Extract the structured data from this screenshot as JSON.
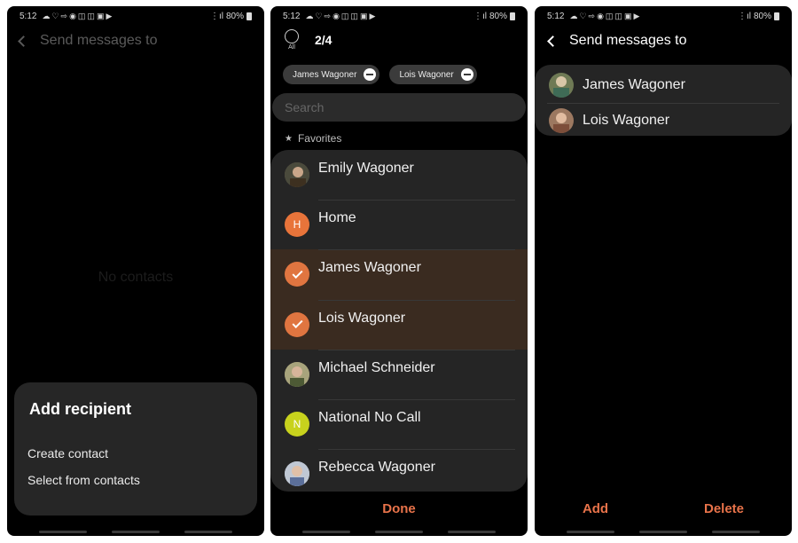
{
  "status_bar": {
    "time": "5:12",
    "battery": "80%"
  },
  "screen1": {
    "header_title": "Send messages to",
    "empty_text": "No contacts",
    "sheet": {
      "title": "Add recipient",
      "items": [
        "Create contact",
        "Select from contacts"
      ]
    }
  },
  "screen2": {
    "all_label": "All",
    "selected_count": "2/4",
    "chips": [
      "James Wagoner",
      "Lois Wagoner"
    ],
    "search_placeholder": "Search",
    "favorites_label": "Favorites",
    "contacts": [
      {
        "name": "Emily Wagoner",
        "avatar": "photo",
        "selected": false
      },
      {
        "name": "Home",
        "initial": "H",
        "avatar_color": "#e8743a",
        "selected": false
      },
      {
        "name": "James Wagoner",
        "avatar": "check",
        "selected": true
      },
      {
        "name": "Lois Wagoner",
        "avatar": "check",
        "selected": true
      },
      {
        "name": "Michael Schneider",
        "avatar": "photo",
        "selected": false
      },
      {
        "name": "National No Call",
        "initial": "N",
        "avatar_color": "#c8d21d",
        "selected": false
      },
      {
        "name": "Rebecca Wagoner",
        "avatar": "photo",
        "selected": false
      }
    ],
    "done_label": "Done"
  },
  "screen3": {
    "header_title": "Send messages to",
    "recipients": [
      "James Wagoner",
      "Lois Wagoner"
    ],
    "add_label": "Add",
    "delete_label": "Delete"
  },
  "colors": {
    "accent": "#e8734a",
    "selected_row": "#3a2b20",
    "card": "#252525"
  }
}
